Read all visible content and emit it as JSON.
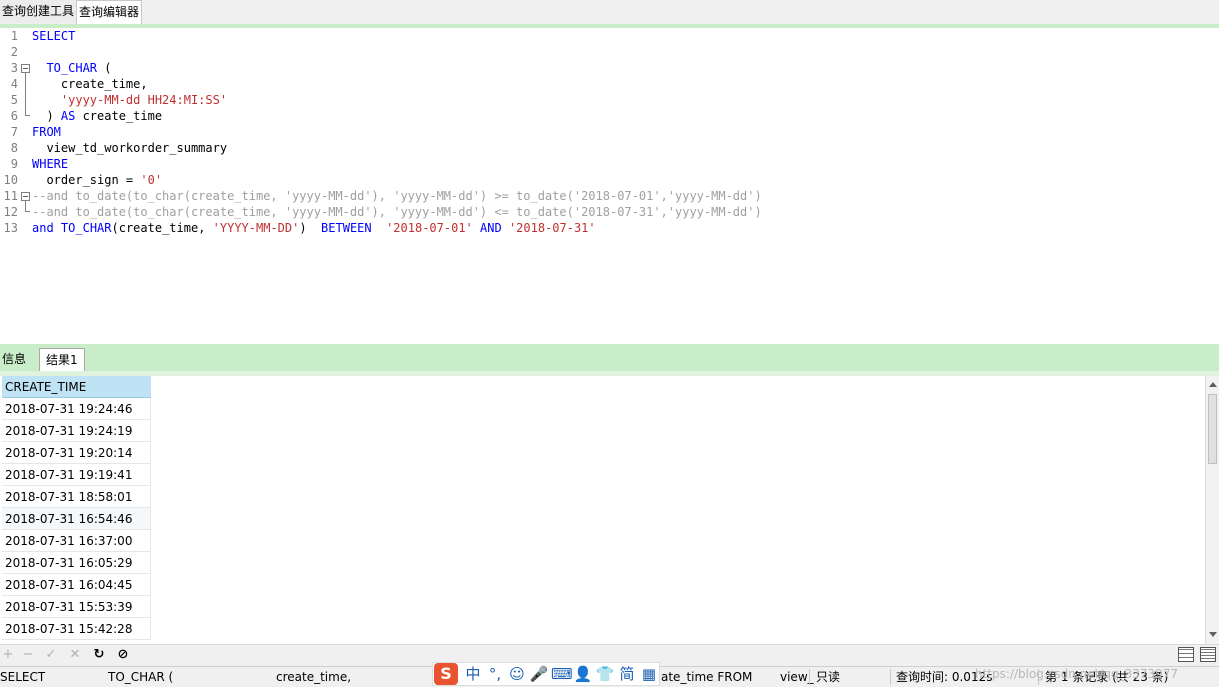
{
  "top_tabs": [
    "查询创建工具",
    "查询编辑器"
  ],
  "editor": {
    "line_numbers": [
      "1",
      "2",
      "3",
      "4",
      "5",
      "6",
      "7",
      "8",
      "9",
      "10",
      "11",
      "12",
      "13"
    ]
  },
  "result_tabs": [
    "信息",
    "结果1"
  ],
  "grid": {
    "column": "CREATE_TIME",
    "rows": [
      "2018-07-31 19:24:46",
      "2018-07-31 19:24:19",
      "2018-07-31 19:20:14",
      "2018-07-31 19:19:41",
      "2018-07-31 18:58:01",
      "2018-07-31 16:54:46",
      "2018-07-31 16:37:00",
      "2018-07-31 16:05:29",
      "2018-07-31 16:04:45",
      "2018-07-31 15:53:39",
      "2018-07-31 15:42:28"
    ]
  },
  "toolbar": {
    "add": "+",
    "remove": "−",
    "apply": "✓",
    "discard": "✕",
    "refresh": "↻",
    "stop": "⊘"
  },
  "status": {
    "sql_1": "SELECT",
    "sql_2": "TO_CHAR (",
    "sql_3": "create_time,",
    "sql_4": "ate_time FROM",
    "sql_5": "view_",
    "readonly": "只读",
    "query_time": "查询时间: 0.012s",
    "records": "第 1 条记录 (共 23 条)"
  },
  "ime": {
    "logo": "S",
    "lang": "中",
    "punct": "°,",
    "emoji": "☺",
    "voice": "🎤",
    "keyboard": "⌨",
    "user": "👤",
    "skin": "👕",
    "simp": "简",
    "apps": "▦"
  },
  "watermark": "https://blog.csdn.net/qq_3373977"
}
